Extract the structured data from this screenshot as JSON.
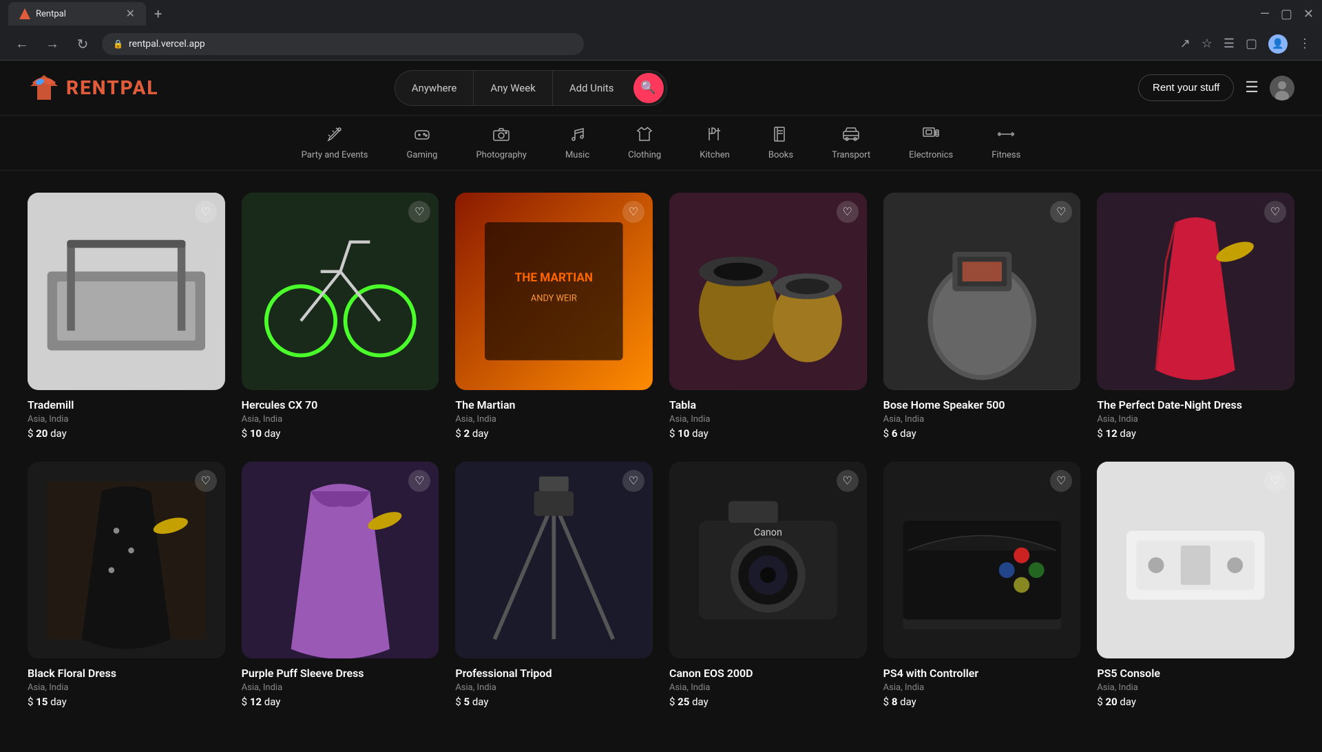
{
  "browser": {
    "tab_title": "Rentpal",
    "tab_favicon": "▲",
    "address": "rentpal.vercel.app",
    "new_tab_label": "+",
    "minimize_label": "—",
    "maximize_label": "▢",
    "close_label": "✕"
  },
  "header": {
    "logo_text": "RENTPAL",
    "search": {
      "location_placeholder": "Anywhere",
      "date_placeholder": "Any Week",
      "units_placeholder": "Add Units",
      "search_icon": "🔍"
    },
    "rent_button_label": "Rent your stuff",
    "menu_icon": "☰"
  },
  "categories": [
    {
      "id": "party",
      "label": "Party and Events",
      "icon": "🎪"
    },
    {
      "id": "gaming",
      "label": "Gaming",
      "icon": "🎮"
    },
    {
      "id": "photography",
      "label": "Photography",
      "icon": "📷"
    },
    {
      "id": "music",
      "label": "Music",
      "icon": "🎵"
    },
    {
      "id": "clothing",
      "label": "Clothing",
      "icon": "👗"
    },
    {
      "id": "kitchen",
      "label": "Kitchen",
      "icon": "🍴"
    },
    {
      "id": "books",
      "label": "Books",
      "icon": "📖"
    },
    {
      "id": "transport",
      "label": "Transport",
      "icon": "🚗"
    },
    {
      "id": "electronics",
      "label": "Electronics",
      "icon": "💻"
    },
    {
      "id": "fitness",
      "label": "Fitness",
      "icon": "🏋️"
    }
  ],
  "products_row1": [
    {
      "id": "treadmill",
      "name": "Trademill",
      "location": "Asia, India",
      "price": "20",
      "period": "day",
      "image_class": "img-treadmill"
    },
    {
      "id": "bike",
      "name": "Hercules CX 70",
      "location": "Asia, India",
      "price": "10",
      "period": "day",
      "image_class": "img-bike"
    },
    {
      "id": "martian",
      "name": "The Martian",
      "location": "Asia, India",
      "price": "2",
      "period": "day",
      "image_class": "img-martian"
    },
    {
      "id": "tabla",
      "name": "Tabla",
      "location": "Asia, India",
      "price": "10",
      "period": "day",
      "image_class": "img-tabla"
    },
    {
      "id": "speaker",
      "name": "Bose Home Speaker 500",
      "location": "Asia, India",
      "price": "6",
      "period": "day",
      "image_class": "img-speaker"
    },
    {
      "id": "dress-red",
      "name": "The Perfect Date-Night Dress",
      "location": "Asia, India",
      "price": "12",
      "period": "day",
      "image_class": "img-dress-red"
    }
  ],
  "products_row2": [
    {
      "id": "dress-black",
      "name": "Black Floral Dress",
      "location": "Asia, India",
      "price": "15",
      "period": "day",
      "image_class": "img-dress-black"
    },
    {
      "id": "dress-purple",
      "name": "Purple Puff Sleeve Dress",
      "location": "Asia, India",
      "price": "12",
      "period": "day",
      "image_class": "img-dress-purple"
    },
    {
      "id": "tripod",
      "name": "Professional Tripod",
      "location": "Asia, India",
      "price": "5",
      "period": "day",
      "image_class": "img-tripod"
    },
    {
      "id": "canon",
      "name": "Canon EOS 200D",
      "location": "Asia, India",
      "price": "25",
      "period": "day",
      "image_class": "img-canon"
    },
    {
      "id": "controller",
      "name": "PS4 with Controller",
      "location": "Asia, India",
      "price": "8",
      "period": "day",
      "image_class": "img-controller"
    },
    {
      "id": "ps5",
      "name": "PS5 Console",
      "location": "Asia, India",
      "price": "20",
      "period": "day",
      "image_class": "img-ps5"
    }
  ]
}
